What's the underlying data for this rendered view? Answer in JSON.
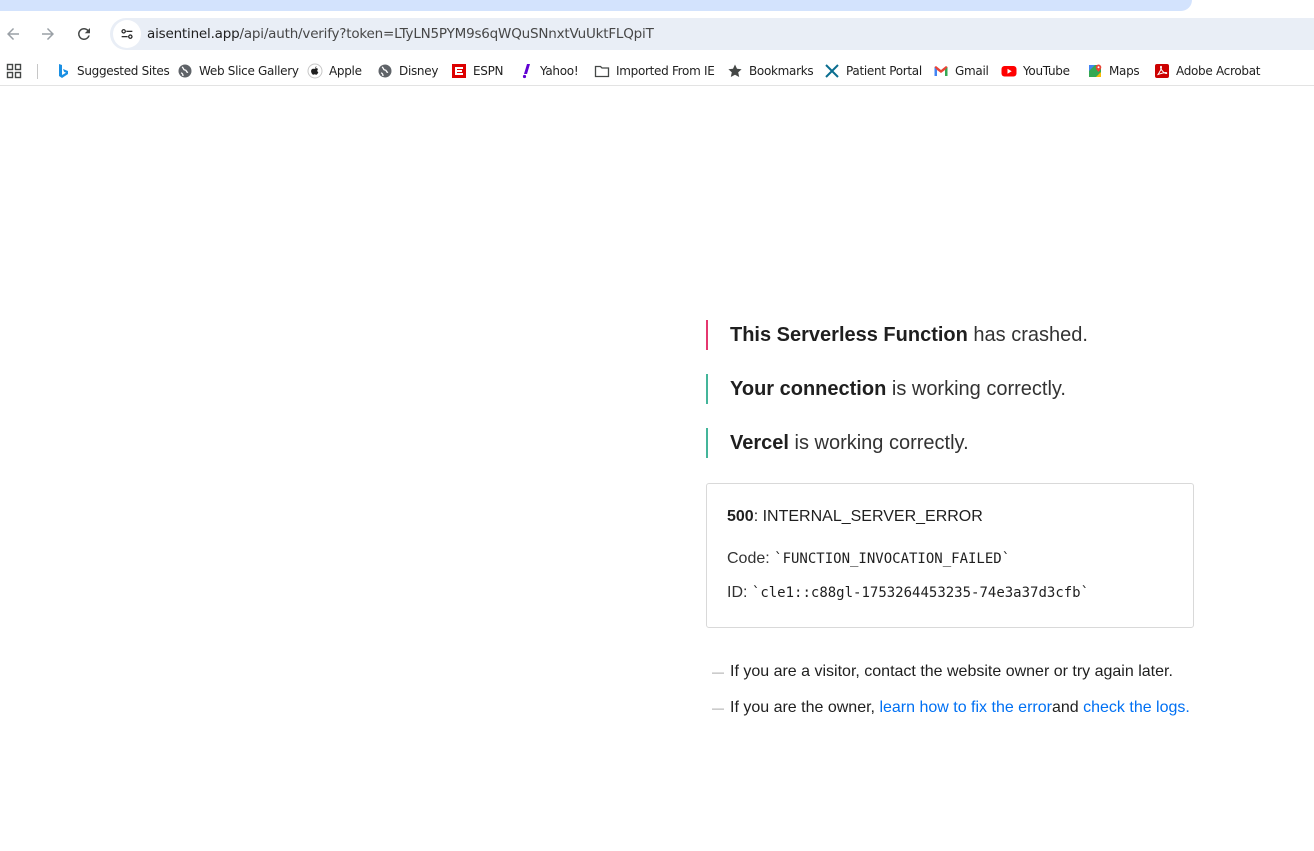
{
  "browser": {
    "url_host": "aisentinel.app",
    "url_path": "/api/auth/verify?token=LTyLN5PYM9s6qWQuSNnxtVuUktFLQpiT"
  },
  "bookmarks": [
    {
      "label": "Suggested Sites",
      "icon": "bing-icon"
    },
    {
      "label": "Web Slice Gallery",
      "icon": "globe-icon"
    },
    {
      "label": "Apple",
      "icon": "apple-icon"
    },
    {
      "label": "Disney",
      "icon": "globe-icon"
    },
    {
      "label": "ESPN",
      "icon": "espn-icon"
    },
    {
      "label": "Yahoo!",
      "icon": "yahoo-icon"
    },
    {
      "label": "Imported From IE",
      "icon": "folder-icon"
    },
    {
      "label": "Bookmarks",
      "icon": "star-icon"
    },
    {
      "label": "Patient Portal",
      "icon": "x-icon"
    },
    {
      "label": "Gmail",
      "icon": "gmail-icon"
    },
    {
      "label": "YouTube",
      "icon": "youtube-icon"
    },
    {
      "label": "Maps",
      "icon": "maps-icon"
    },
    {
      "label": "Adobe Acrobat",
      "icon": "acrobat-icon"
    }
  ],
  "status": {
    "function": {
      "bold": "This Serverless Function",
      "rest": " has crashed.",
      "color": "#e5376f"
    },
    "connection": {
      "bold": "Your connection",
      "rest": " is working correctly.",
      "color": "#44b59a"
    },
    "vercel": {
      "bold": "Vercel",
      "rest": " is working correctly.",
      "color": "#44b59a"
    }
  },
  "error": {
    "status_code": "500",
    "status_text": ": INTERNAL_SERVER_ERROR",
    "code_label": "Code: ",
    "code_value": "`FUNCTION_INVOCATION_FAILED`",
    "id_label": "ID: ",
    "id_value": "`cle1::c88gl-1753264453235-74e3a37d3cfb`"
  },
  "help": {
    "visitor": "If you are a visitor, contact the website owner or try again later.",
    "owner_prefix": "If you are the owner, ",
    "owner_link1": "learn how to fix the error",
    "owner_middle": " and ",
    "owner_link2": "check the logs",
    "owner_suffix": ".",
    "dash": "—"
  }
}
